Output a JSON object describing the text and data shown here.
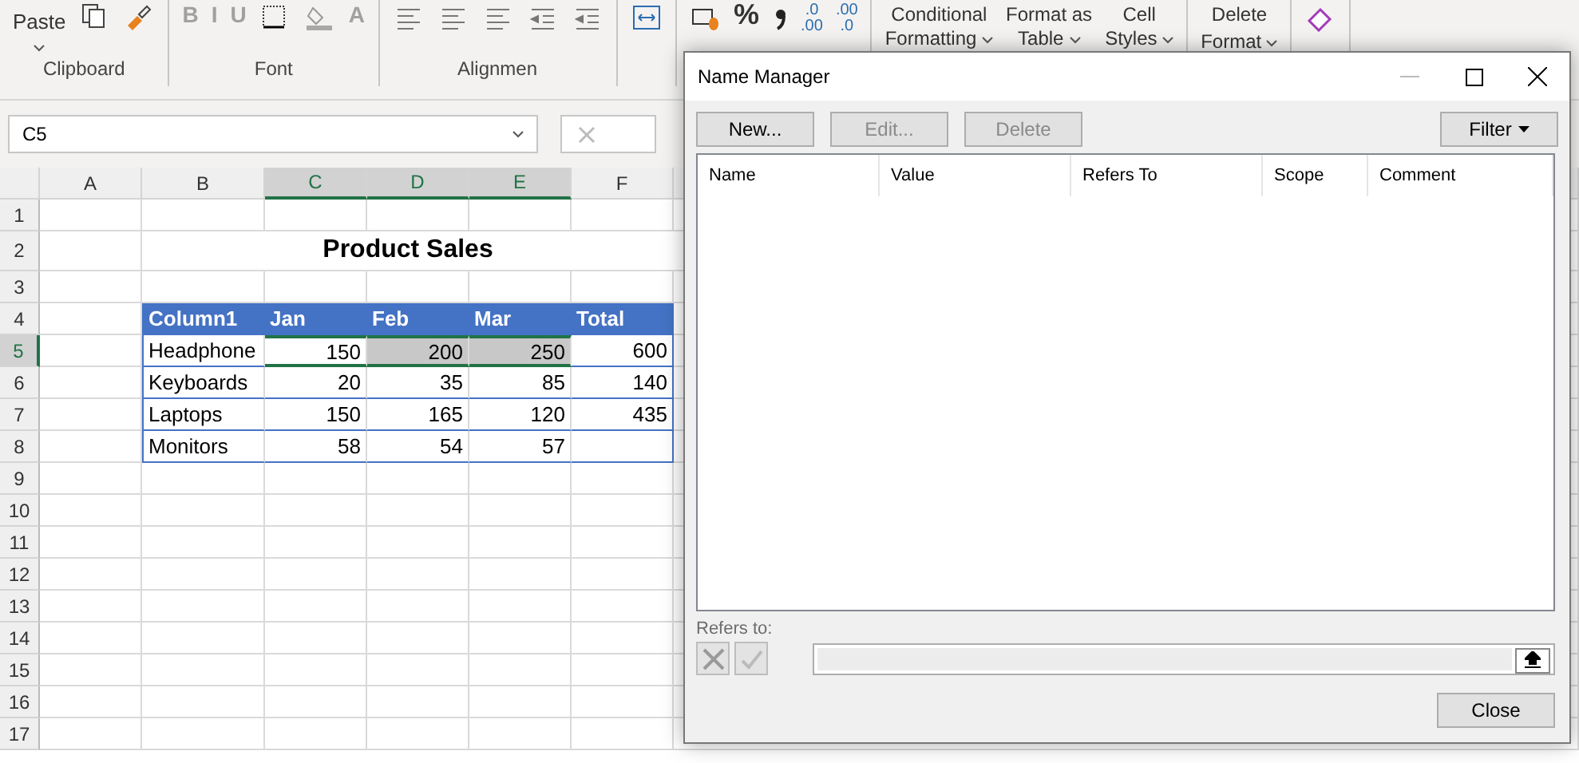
{
  "ribbon": {
    "groups": [
      {
        "label": "Clipboard",
        "commands": [
          {
            "kind": "big",
            "label": "Paste"
          },
          {
            "kind": "copy"
          },
          {
            "kind": "brush"
          }
        ]
      },
      {
        "label": "Font",
        "commands": [
          {
            "kind": "text",
            "label": "B"
          },
          {
            "kind": "text",
            "label": "I"
          },
          {
            "kind": "text",
            "label": "U"
          },
          {
            "kind": "border"
          },
          {
            "kind": "fill"
          },
          {
            "kind": "text",
            "label": "A"
          }
        ]
      },
      {
        "label": "Alignmen",
        "commands": [
          {
            "kind": "align"
          },
          {
            "kind": "align"
          },
          {
            "kind": "align"
          },
          {
            "kind": "indent"
          },
          {
            "kind": "indent"
          }
        ]
      },
      {
        "commands": [
          {
            "kind": "merge"
          }
        ]
      },
      {
        "commands": [
          {
            "kind": "currency"
          },
          {
            "kind": "text",
            "label": "%"
          },
          {
            "kind": "comma"
          },
          {
            "kind": "decimal",
            "label": ".0",
            "sub": ".00"
          },
          {
            "kind": "decimal",
            "label": ".00",
            "sub": ".0"
          }
        ]
      },
      {
        "commands": [
          {
            "kind": "two",
            "label": "Conditional",
            "sub": "Formatting"
          },
          {
            "kind": "two",
            "label": "Format as",
            "sub": "Table"
          },
          {
            "kind": "two",
            "label": "Cell",
            "sub": "Styles"
          }
        ]
      },
      {
        "commands": [
          {
            "kind": "stack",
            "label": "Delete",
            "sub": "Format"
          }
        ]
      },
      {
        "commands": [
          {
            "kind": "eraser"
          }
        ]
      }
    ]
  },
  "name_box": "C5",
  "sheet": {
    "columns": [
      {
        "label": "A",
        "selected": false
      },
      {
        "label": "B",
        "selected": false
      },
      {
        "label": "C",
        "selected": true
      },
      {
        "label": "D",
        "selected": true
      },
      {
        "label": "E",
        "selected": true
      },
      {
        "label": "F",
        "selected": false
      }
    ],
    "row_numbers": [
      {
        "label": "1",
        "selected": false
      },
      {
        "label": "2",
        "selected": false
      },
      {
        "label": "3",
        "selected": false
      },
      {
        "label": "4",
        "selected": false
      },
      {
        "label": "5",
        "selected": true
      },
      {
        "label": "6",
        "selected": false
      },
      {
        "label": "7",
        "selected": false
      },
      {
        "label": "8",
        "selected": false
      },
      {
        "label": "9",
        "selected": false
      },
      {
        "label": "10",
        "selected": false
      },
      {
        "label": "11",
        "selected": false
      },
      {
        "label": "12",
        "selected": false
      },
      {
        "label": "13",
        "selected": false
      },
      {
        "label": "14",
        "selected": false
      },
      {
        "label": "15",
        "selected": false
      },
      {
        "label": "16",
        "selected": false
      },
      {
        "label": "17",
        "selected": false
      }
    ],
    "title": "Product Sales",
    "table": {
      "columns": [
        "Column1",
        "Jan",
        "Feb",
        "Mar",
        "Total"
      ],
      "rows": [
        {
          "cells": [
            {
              "text": "Headphone",
              "selected": false
            },
            {
              "text": "150",
              "selected": true
            },
            {
              "text": "200",
              "selected": true
            },
            {
              "text": "250",
              "selected": true
            },
            {
              "text": "600",
              "selected": false
            }
          ]
        },
        {
          "cells": [
            {
              "text": "Keyboards",
              "selected": false
            },
            {
              "text": "20",
              "selected": false
            },
            {
              "text": "35",
              "selected": false
            },
            {
              "text": "85",
              "selected": false
            },
            {
              "text": "140",
              "selected": false
            }
          ]
        },
        {
          "cells": [
            {
              "text": "Laptops",
              "selected": false
            },
            {
              "text": "150",
              "selected": false
            },
            {
              "text": "165",
              "selected": false
            },
            {
              "text": "120",
              "selected": false
            },
            {
              "text": "435",
              "selected": false
            }
          ]
        },
        {
          "cells": [
            {
              "text": "Monitors",
              "selected": false
            },
            {
              "text": "58",
              "selected": false
            },
            {
              "text": "54",
              "selected": false
            },
            {
              "text": "57",
              "selected": false
            },
            {
              "text": "",
              "selected": false
            }
          ]
        }
      ]
    }
  },
  "dialog": {
    "title": "Name Manager",
    "buttons": [
      {
        "label": "New...",
        "disabled": false
      },
      {
        "label": "Edit...",
        "disabled": true
      },
      {
        "label": "Delete",
        "disabled": true
      }
    ],
    "filter": "Filter",
    "columns": [
      "Name",
      "Value",
      "Refers To",
      "Scope",
      "Comment"
    ],
    "refers_to_label": "Refers to:",
    "close": "Close"
  }
}
